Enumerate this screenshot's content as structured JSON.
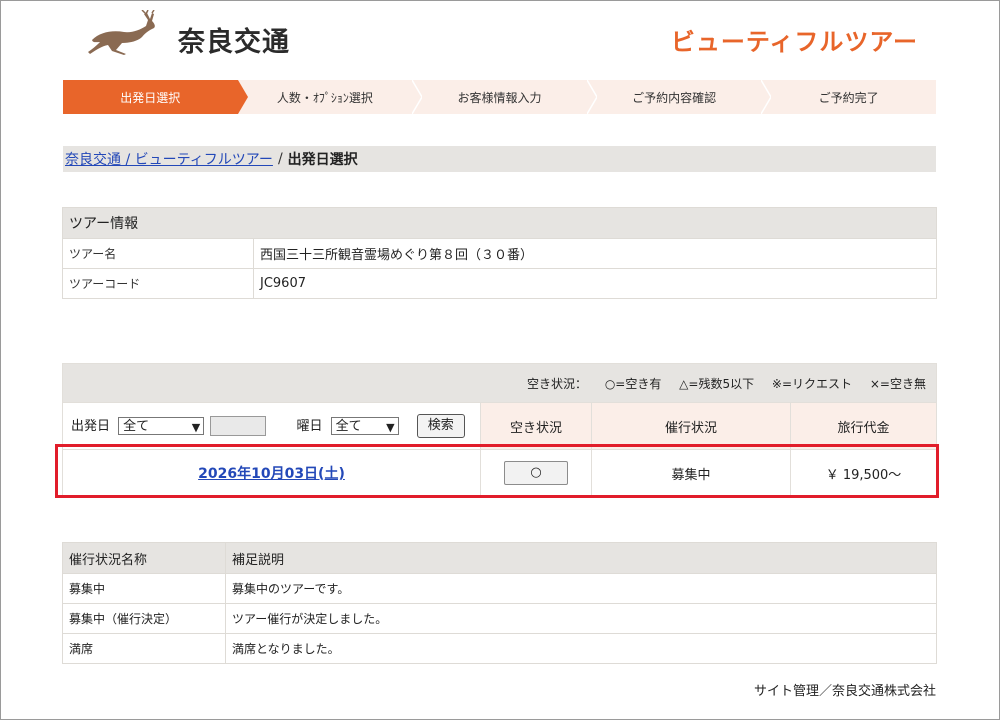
{
  "header": {
    "logo_text": "奈良交通",
    "brand": "ビューティフルツアー"
  },
  "steps": [
    {
      "label": "出発日選択",
      "active": true
    },
    {
      "label": "人数・ｵﾌﾟｼｮﾝ選択",
      "active": false
    },
    {
      "label": "お客様情報入力",
      "active": false
    },
    {
      "label": "ご予約内容確認",
      "active": false
    },
    {
      "label": "ご予約完了",
      "active": false
    }
  ],
  "breadcrumb": {
    "link": "奈良交通 / ビューティフルツアー",
    "separator": "/",
    "current": "出発日選択"
  },
  "tour_info": {
    "heading": "ツアー情報",
    "name_label": "ツアー名",
    "name_value": "西国三十三所観音霊場めぐり第８回（３０番）",
    "code_label": "ツアーコード",
    "code_value": "JC9607"
  },
  "availability": {
    "legend_label": "空き状況：",
    "legend_items": [
      "○=空き有",
      "△=残数5以下",
      "※=リクエスト",
      "×=空き無"
    ],
    "filter": {
      "departure_label": "出発日",
      "departure_value": "全て",
      "weekday_label": "曜日",
      "weekday_value": "全て",
      "search_button": "検索"
    },
    "columns": [
      "空き状況",
      "催行状況",
      "旅行代金"
    ],
    "rows": [
      {
        "date": "2026年10月03日(土)",
        "availability": "○",
        "status": "募集中",
        "price": "￥ 19,500～"
      }
    ]
  },
  "status_legend": {
    "headers": [
      "催行状況名称",
      "補足説明"
    ],
    "rows": [
      {
        "name": "募集中",
        "desc": "募集中のツアーです。"
      },
      {
        "name": "募集中（催行決定）",
        "desc": "ツアー催行が決定しました。"
      },
      {
        "name": "満席",
        "desc": "満席となりました。"
      }
    ]
  },
  "footer": {
    "text": "サイト管理／奈良交通株式会社"
  },
  "colors": {
    "accent": "#e8652a",
    "step_bg": "#fbeee8",
    "header_bg": "#e6e4e1",
    "link": "#2348b8",
    "highlight": "#e11d2a"
  }
}
